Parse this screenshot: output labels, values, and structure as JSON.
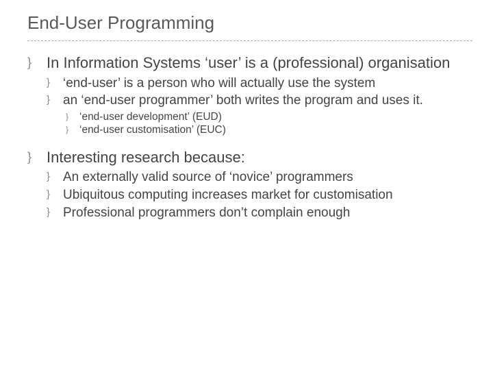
{
  "title": "End-User Programming",
  "bullets": [
    {
      "text": "In Information Systems ‘user’ is a (professional) organisation",
      "children": [
        {
          "text": "‘end-user’ is a person who will actually use the system"
        },
        {
          "text": "an ‘end-user programmer’ both writes the program and uses it.",
          "children": [
            {
              "text": "‘end-user development’ (EUD)"
            },
            {
              "text": "‘end-user customisation’ (EUC)"
            }
          ]
        }
      ]
    },
    {
      "text": "Interesting research because:",
      "children": [
        {
          "text": "An externally valid source of ‘novice’ programmers"
        },
        {
          "text": "Ubiquitous computing increases market for customisation"
        },
        {
          "text": "Professional programmers don’t complain enough"
        }
      ]
    }
  ]
}
